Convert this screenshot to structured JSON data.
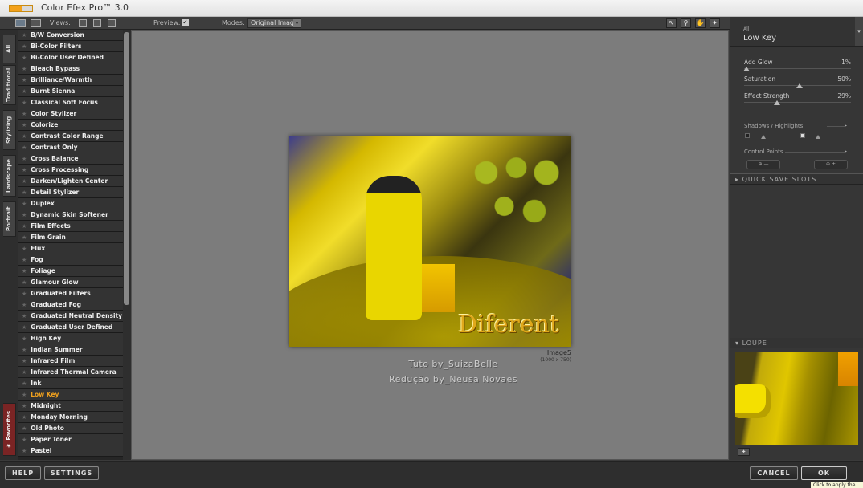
{
  "window": {
    "title": "Color Efex Pro™ 3.0"
  },
  "toolbar": {
    "views_label": "Views:",
    "preview_label": "Preview:",
    "preview_checked": "✓",
    "modes_label": "Modes:",
    "modes_value": "Original Image",
    "tools": [
      "arrow-icon",
      "zoom-icon",
      "hand-icon",
      "loupe-pin-icon"
    ]
  },
  "side_tabs": [
    "All",
    "Traditional",
    "Stylizing",
    "Landscape",
    "Portrait",
    "Favorites"
  ],
  "filters": [
    "B/W Conversion",
    "Bi-Color Filters",
    "Bi-Color User Defined",
    "Bleach Bypass",
    "Brilliance/Warmth",
    "Burnt Sienna",
    "Classical Soft Focus",
    "Color Stylizer",
    "Colorize",
    "Contrast Color Range",
    "Contrast Only",
    "Cross Balance",
    "Cross Processing",
    "Darken/Lighten Center",
    "Detail Stylizer",
    "Duplex",
    "Dynamic Skin Softener",
    "Film Effects",
    "Film Grain",
    "Flux",
    "Fog",
    "Foliage",
    "Glamour Glow",
    "Graduated Filters",
    "Graduated Fog",
    "Graduated Neutral Density",
    "Graduated User Defined",
    "High Key",
    "Indian Summer",
    "Infrared Film",
    "Infrared Thermal Camera",
    "Ink",
    "Low Key",
    "Midnight",
    "Monday Morning",
    "Old Photo",
    "Paper Toner",
    "Pastel"
  ],
  "selected_filter": "Low Key",
  "preview": {
    "watermark": "Diferent",
    "image_name": "Image5",
    "image_size": "(1000 x 750)",
    "credit_line1": "Tuto by_SuizaBelle",
    "credit_line2": "Redução by_Neusa Novaes"
  },
  "right_panel": {
    "category": "All",
    "filter_name": "Low Key",
    "sliders": [
      {
        "label": "Add Glow",
        "value": "1%",
        "level": 0.01
      },
      {
        "label": "Saturation",
        "value": "50%",
        "level": 0.5
      },
      {
        "label": "Effect Strength",
        "value": "29%",
        "level": 0.29
      }
    ],
    "shadows_label": "Shadows / Highlights",
    "control_points_label": "Control Points",
    "quick_save_label": "QUICK SAVE SLOTS",
    "loupe_label": "LOUPE"
  },
  "bottom": {
    "help": "HELP",
    "settings": "SETTINGS",
    "cancel": "CANCEL",
    "ok": "OK",
    "tooltip": "Click to apply the"
  },
  "colors": {
    "selected_filter": "#f2a21e",
    "favorites_tab": "#7a2424"
  }
}
